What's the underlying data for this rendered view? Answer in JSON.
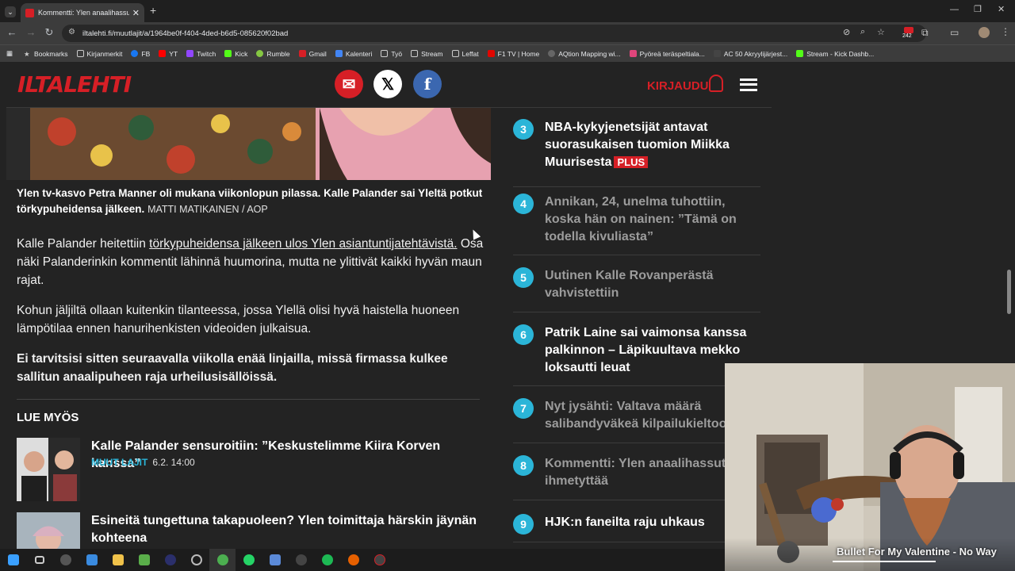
{
  "browser": {
    "tab_title": "Kommentti: Ylen anaalihassutt",
    "url": "iltalehti.fi/muutlajit/a/1964be0f-f404-4ded-b6d5-085620f02bad",
    "badge_count": "242"
  },
  "bookmarks": [
    "Bookmarks",
    "Kirjanmerkit",
    "FB",
    "YT",
    "Twitch",
    "Kick",
    "Rumble",
    "Gmail",
    "Kalenteri",
    "Työ",
    "Stream",
    "Leffat",
    "F1 TV | Home",
    "AQtion Mapping wi...",
    "Pyöreä teräspeltiala...",
    "AC 50 Akryylijärjest...",
    "Stream - Kick Dashb..."
  ],
  "site": {
    "logo": "ILTALEHTI",
    "login_label": "KIRJAUDU",
    "colors": {
      "brand": "#d61f26",
      "accent": "#2bb5d8"
    }
  },
  "article": {
    "caption": "Ylen tv-kasvo Petra Manner oli mukana viikonlopun pilassa. Kalle Palander sai Yleltä potkut törkypuheidensa jälkeen.",
    "caption_credit": "MATTI MATIKAINEN / AOP",
    "p1_start": "Kalle Palander heitettiin ",
    "p1_link": "törkypuheidensa jälkeen ulos Ylen asiantuntijatehtävistä.",
    "p1_end": " Osa näki Palanderinkin kommentit lähinnä huumorina, mutta ne ylittivät kaikki hyvän maun rajat.",
    "p2": "Kohun jäljiltä ollaan kuitenkin tilanteessa, jossa Ylellä olisi hyvä haistella huoneen lämpötilaa ennen hanurihenkisten videoiden julkaisua.",
    "p3": "Ei tarvitsisi sitten seuraavalla viikolla enää linjailla, missä firmassa kulkee sallitun anaalipuheen raja urheilusisällöissä.",
    "lue_myos": "LUE MYÖS",
    "related": [
      {
        "title": "Kalle Palander sensuroitiin: ”Keskustelimme Kiira Korven kanssa”",
        "section": "MUUT LAJIT",
        "date": "6.2. 14:00"
      },
      {
        "title": "Esineitä tungettuna takapuoleen? Ylen toimittaja härskin jäynän kohteena"
      }
    ]
  },
  "sidebar": {
    "items": [
      {
        "num": "3",
        "title": "NBA-kykyjenetsijät antavat suorasukaisen tuomion Miikka Muurisesta",
        "plus": "PLUS"
      },
      {
        "num": "4",
        "title": "Annikan, 24, unelma tuhottiin, koska hän on nainen: ”Tämä on todella kivuliasta”"
      },
      {
        "num": "5",
        "title": "Uutinen Kalle Rovanperästä vahvistettiin"
      },
      {
        "num": "6",
        "title": "Patrik Laine sai vaimonsa kanssa palkinnon – Läpikuultava mekko loksautti leuat"
      },
      {
        "num": "7",
        "title": "Nyt jysähti: Valtava määrä salibandyväkeä kilpailukieltoon"
      },
      {
        "num": "8",
        "title": "Kommentti: Ylen anaalihassuttel ihmetyttää"
      },
      {
        "num": "9",
        "title": "HJK:n faneilta raju uhkaus"
      }
    ]
  },
  "now_playing": {
    "artist": "Bullet For My Valentine",
    "song": "No Way",
    "sep": "-"
  }
}
